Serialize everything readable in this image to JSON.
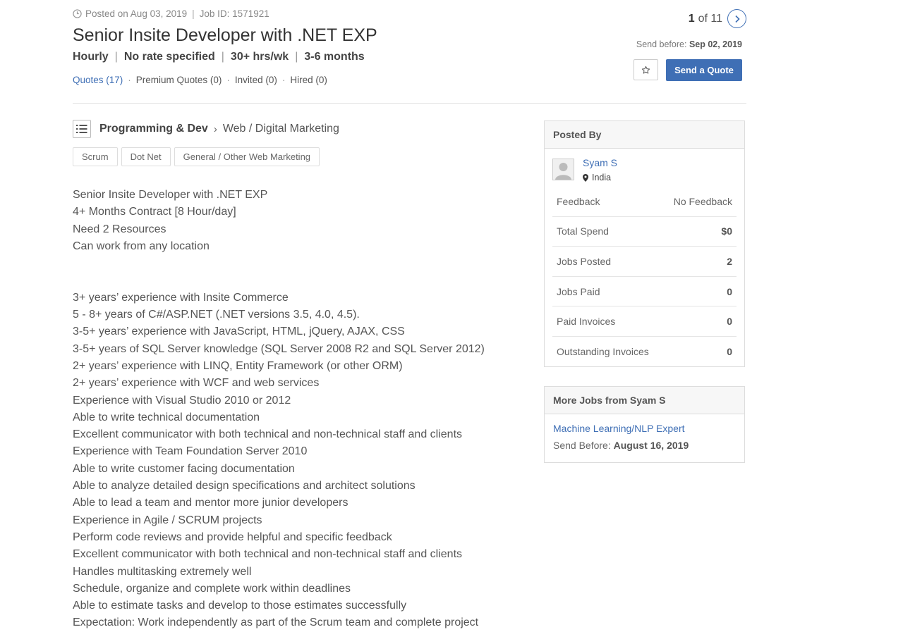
{
  "header": {
    "posted": "Posted on Aug 03, 2019",
    "job_id": "Job ID: 1571921",
    "title": "Senior Insite Developer with .NET EXP",
    "meta": {
      "rate_type": "Hourly",
      "rate": "No rate specified",
      "hours": "30+ hrs/wk",
      "duration": "3-6 months"
    },
    "quotes": "Quotes (17)",
    "premium_quotes": "Premium Quotes (0)",
    "invited": "Invited (0)",
    "hired": "Hired (0)"
  },
  "pager": {
    "current": "1",
    "total": "of 11",
    "next_icon": "chevron-right-icon"
  },
  "send_before": {
    "label": "Send before:",
    "date": "Sep 02, 2019"
  },
  "actions": {
    "star_icon": "star-outline-icon",
    "send_quote": "Send a Quote"
  },
  "category": {
    "icon": "list-icon",
    "main": "Programming & Dev",
    "separator": "›",
    "sub": "Web / Digital Marketing"
  },
  "tags": [
    "Scrum",
    "Dot Net",
    "General / Other Web Marketing"
  ],
  "description": {
    "intro": [
      "Senior Insite Developer with .NET EXP",
      "4+ Months Contract [8 Hour/day]",
      "Need 2 Resources",
      "Can work from any location"
    ],
    "requirements": [
      "3+ years’ experience with Insite Commerce",
      "5 - 8+ years of C#/ASP.NET (.NET versions 3.5, 4.0, 4.5).",
      "3-5+ years’ experience with JavaScript, HTML, jQuery, AJAX, CSS",
      "3-5+ years of SQL Server knowledge (SQL Server 2008 R2 and SQL Server 2012)",
      "2+ years’ experience with LINQ, Entity Framework (or other ORM)",
      "2+ years’ experience with WCF and web services",
      "Experience with Visual Studio 2010 or 2012",
      "Able to write technical documentation",
      "Excellent communicator with both technical and non-technical staff and clients",
      "Experience with Team Foundation Server 2010",
      "Able to write customer facing documentation",
      "Able to analyze detailed design specifications and architect solutions",
      "Able to lead a team and mentor more junior developers",
      "Experience in Agile / SCRUM projects",
      "Perform code reviews and provide helpful and specific feedback",
      "Excellent communicator with both technical and non-technical staff and clients",
      "Handles multitasking extremely well",
      "Schedule, organize and complete work within deadlines",
      "Able to estimate tasks and develop to those estimates successfully",
      "Expectation: Work independently as part of the Scrum team and complete project"
    ]
  },
  "posted_by": {
    "heading": "Posted By",
    "name": "Syam S",
    "location": "India",
    "stats": [
      {
        "label": "Feedback",
        "value": "No Feedback"
      },
      {
        "label": "Total Spend",
        "value": "$0"
      },
      {
        "label": "Jobs Posted",
        "value": "2"
      },
      {
        "label": "Jobs Paid",
        "value": "0"
      },
      {
        "label": "Paid Invoices",
        "value": "0"
      },
      {
        "label": "Outstanding Invoices",
        "value": "0"
      }
    ]
  },
  "more_jobs": {
    "heading": "More Jobs from Syam S",
    "job_title": "Machine Learning/NLP Expert",
    "send_label": "Send Before:",
    "send_date": "August 16, 2019"
  },
  "colors": {
    "accent": "#3f6fb5"
  }
}
